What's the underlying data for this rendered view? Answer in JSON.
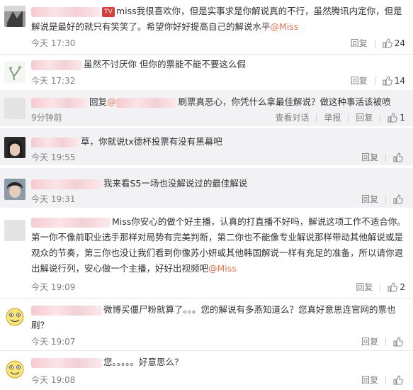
{
  "ui": {
    "reply_label": "回复",
    "view_conversation_label": "查看对话",
    "report_label": "举报"
  },
  "comments": [
    {
      "id": "c1",
      "badge_icon": "tv-badge-icon",
      "text": "miss我很喜欢你，但是实事求是你解说真的不行，虽然腾讯内定你，但是解说是最好的就只有笑笑了。希望你好好提高自己的解说水平",
      "mention": "@Miss",
      "time": "今天 17:30",
      "likes": "24"
    },
    {
      "id": "c2",
      "text": "虽然不讨厌你 但你的票能不能不要这么假",
      "time": "今天 17:32",
      "likes": "14"
    },
    {
      "id": "c3",
      "reply_prefix": "回复",
      "mention": "@",
      "text": "刷票真恶心，你凭什么拿最佳解说？做这种事活该被喷",
      "time": "9分钟前",
      "likes": "1"
    },
    {
      "id": "c4",
      "text": "草，你就说tx德杯投票有没有黑幕吧",
      "time": "今天 19:55",
      "likes": ""
    },
    {
      "id": "c5",
      "text": "我来看S5一场也没解说过的最佳解说",
      "time": "今天 19:31",
      "likes": ""
    },
    {
      "id": "c6",
      "text": "Miss你安心的做个好主播，认真的打直播不好吗，解说这项工作不适合你。第一你不像前职业选手那样对局势有完美判断，第二你也不能像专业解说那样带动其他解说或是观众的节奏，第三你也没让我们看到你像苏小妍或其他韩国解说一样有充足的准备，所以请你退出解说行列，安心做一个主播，好好出视频吧",
      "mention": "@Miss",
      "time": "今天 19:09",
      "likes": "2"
    },
    {
      "id": "c7",
      "text": "微博买僵尸粉就算了。。。您的解说有多燕知道么？您真好意思连官网的票也刷？",
      "time": "今天 19:07",
      "likes": ""
    },
    {
      "id": "c8",
      "text": "您。。。。。好意思么？",
      "time": "今天 19:08",
      "likes": ""
    }
  ]
}
